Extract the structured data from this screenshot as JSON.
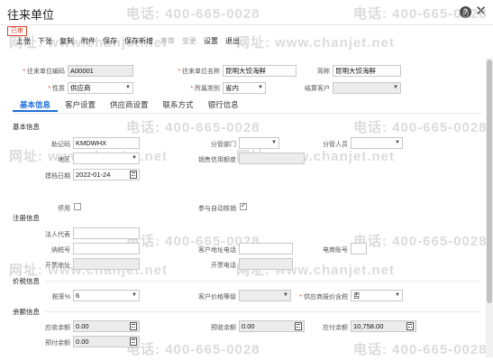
{
  "window": {
    "title": "往来单位"
  },
  "status_badge": "已审",
  "toolbar": {
    "items": [
      "上张",
      "下张",
      "复制",
      "附件",
      "保存",
      "保存新增",
      "弃审",
      "变更",
      "设置",
      "退出"
    ]
  },
  "header_fields": {
    "code": {
      "label": "往来单位编码",
      "value": "A00001"
    },
    "name": {
      "label": "往来单位名称",
      "value": "昆明大饺海鲜"
    },
    "short_name": {
      "label": "简称",
      "value": "昆明大饺海鲜"
    },
    "nature": {
      "label": "性质",
      "value": "供应商"
    },
    "category": {
      "label": "所属类别",
      "value": "省内"
    },
    "settle_customer": {
      "label": "结算客户",
      "value": ""
    }
  },
  "tabs": [
    "基本信息",
    "客户设置",
    "供应商设置",
    "联系方式",
    "银行信息"
  ],
  "sections": {
    "basic": "基本信息",
    "register": "注册信息",
    "price": "价税信息",
    "balance": "余额信息"
  },
  "basic": {
    "mnemonic": {
      "label": "助记码",
      "value": "KMDWHX"
    },
    "dept": {
      "label": "分管部门",
      "value": ""
    },
    "staff": {
      "label": "分管人员",
      "value": ""
    },
    "region": {
      "label": "地区",
      "value": ""
    },
    "credit": {
      "label": "销售信用额度",
      "value": ""
    },
    "created": {
      "label": "建档日期",
      "value": "2022-01-24"
    },
    "disabled": {
      "label": "停用"
    },
    "auto_verify": {
      "label": "参与自动核销"
    }
  },
  "register": {
    "legal": {
      "label": "法人代表",
      "value": ""
    },
    "tax_no": {
      "label": "纳税号",
      "value": ""
    },
    "cust_addr_phone": {
      "label": "客户地址电话",
      "value": ""
    },
    "ecom_account": {
      "label": "电商账号",
      "value": ""
    },
    "open_addr": {
      "label": "开票地址",
      "value": ""
    },
    "open_phone": {
      "label": "开票电话",
      "value": ""
    }
  },
  "price": {
    "tax_rate": {
      "label": "税率%",
      "value": "6"
    },
    "cust_price_level": {
      "label": "客户价格等级",
      "value": ""
    },
    "supplier_price_tax": {
      "label": "供应商报价含税",
      "value": "否"
    }
  },
  "balance": {
    "receivable": {
      "label": "应收余额",
      "value": "0.00"
    },
    "prepaid_recv": {
      "label": "预收余额",
      "value": "0.00"
    },
    "payable": {
      "label": "应付余额",
      "value": "10,758.00"
    },
    "prepaid_pay": {
      "label": "预付余额",
      "value": "0.00"
    }
  },
  "watermark": {
    "phone": "电话: 400-665-0028",
    "site": "网址: www.chanjet.net"
  }
}
